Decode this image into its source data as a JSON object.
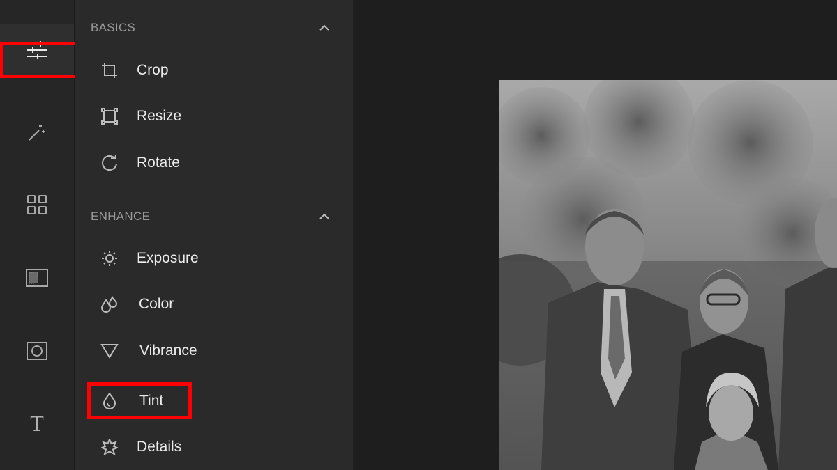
{
  "rail": {
    "items": [
      {
        "icon": "sliders-icon",
        "active": true
      },
      {
        "icon": "magic-wand-icon"
      },
      {
        "icon": "grid-icon"
      },
      {
        "icon": "texture-frame-icon"
      },
      {
        "icon": "vignette-frame-icon"
      },
      {
        "icon": "text-icon",
        "glyph": "T"
      }
    ]
  },
  "panel": {
    "basics": {
      "title": "BASICS",
      "tools": [
        {
          "label": "Crop",
          "icon": "crop-icon"
        },
        {
          "label": "Resize",
          "icon": "resize-icon"
        },
        {
          "label": "Rotate",
          "icon": "rotate-icon"
        }
      ]
    },
    "enhance": {
      "title": "ENHANCE",
      "tools": [
        {
          "label": "Exposure",
          "icon": "sun-icon"
        },
        {
          "label": "Color",
          "icon": "droplets-icon"
        },
        {
          "label": "Vibrance",
          "icon": "triangle-icon"
        },
        {
          "label": "Tint",
          "icon": "drop-icon"
        },
        {
          "label": "Details",
          "icon": "star-burst-icon"
        }
      ]
    }
  },
  "colors": {
    "highlight": "#ff0000",
    "rail_bg": "#262626",
    "panel_bg": "#2a2a2a",
    "canvas_bg": "#1e1e1e"
  }
}
